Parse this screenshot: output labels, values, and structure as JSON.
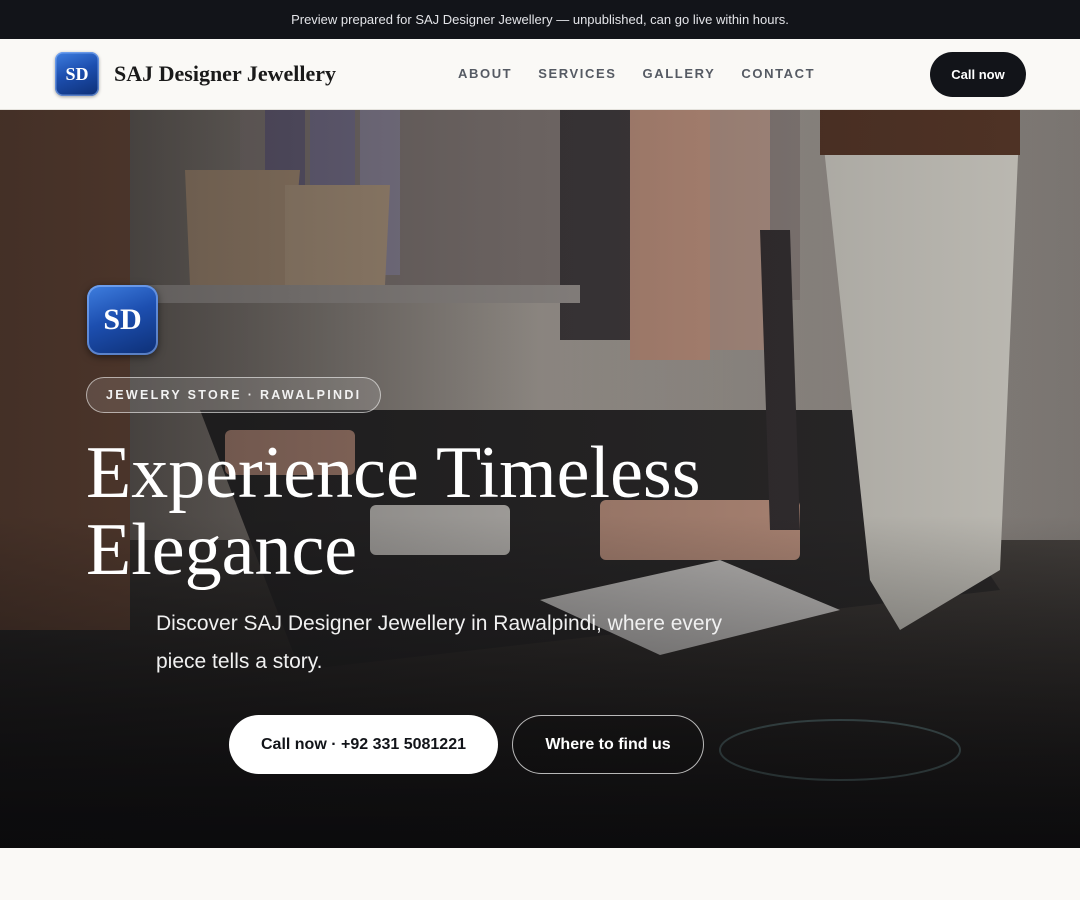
{
  "announcement": "Preview prepared for SAJ Designer Jewellery — unpublished, can go live within hours.",
  "header": {
    "logo_initials": "SD",
    "brand_name": "SAJ Designer Jewellery",
    "nav": [
      "ABOUT",
      "SERVICES",
      "GALLERY",
      "CONTACT"
    ],
    "cta_label": "Call now"
  },
  "hero": {
    "logo_initials": "SD",
    "category_pill": "JEWELRY STORE · RAWALPINDI",
    "title": "Experience Timeless Elegance",
    "subtitle": "Discover SAJ Designer Jewellery in Rawalpindi, where every piece tells a story.",
    "primary_button": "Call now · +92 331 5081221",
    "secondary_button": "Where to find us"
  },
  "colors": {
    "dark": "#121419",
    "brand_blue": "#1d4fb0",
    "background": "#faf9f6"
  }
}
